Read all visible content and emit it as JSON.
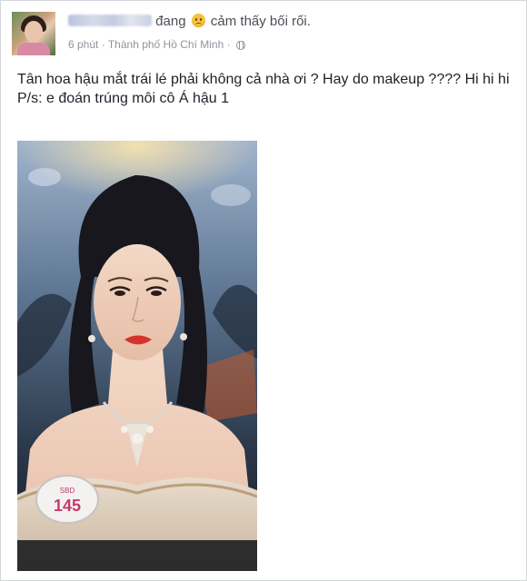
{
  "post": {
    "author_name": "",
    "status_word": "đang",
    "feeling_icon": "sad-face-emoji-icon",
    "feeling_text": "cảm thấy bối rối.",
    "time": "6 phút",
    "separator": "·",
    "location": "Thành phố Hồ Chí Minh",
    "privacy_icon": "globe-icon",
    "text_line1": "Tân hoa hậu mắt trái lé phải không cả nhà ơi ? Hay do makeup ???? Hi hi hi",
    "text_line2": "P/s: e đoán trúng môi cô Á hậu 1",
    "photo": {
      "sash_number": "145",
      "sash_label": "SBD"
    }
  },
  "colors": {
    "text": "#1d2129",
    "meta": "#90949c",
    "border": "#d3d6db",
    "lips": "#d8322e"
  }
}
